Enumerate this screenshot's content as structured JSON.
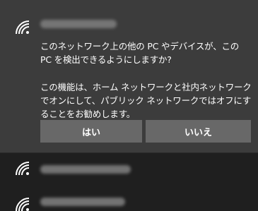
{
  "prompt": {
    "question": "このネットワーク上の他の PC やデバイスが、この PC を検出できるようにしますか?",
    "description": "この機能は、ホーム ネットワークと社内ネットワークでオンにして、パブリック ネットワークではオフにすることをお勧めします。"
  },
  "buttons": {
    "yes": "はい",
    "no": "いいえ"
  },
  "icons": {
    "network": "wifi-signal-icon"
  },
  "colors": {
    "panel": "#3c3c3c",
    "button": "#686868",
    "background": "#1f1f1f"
  }
}
